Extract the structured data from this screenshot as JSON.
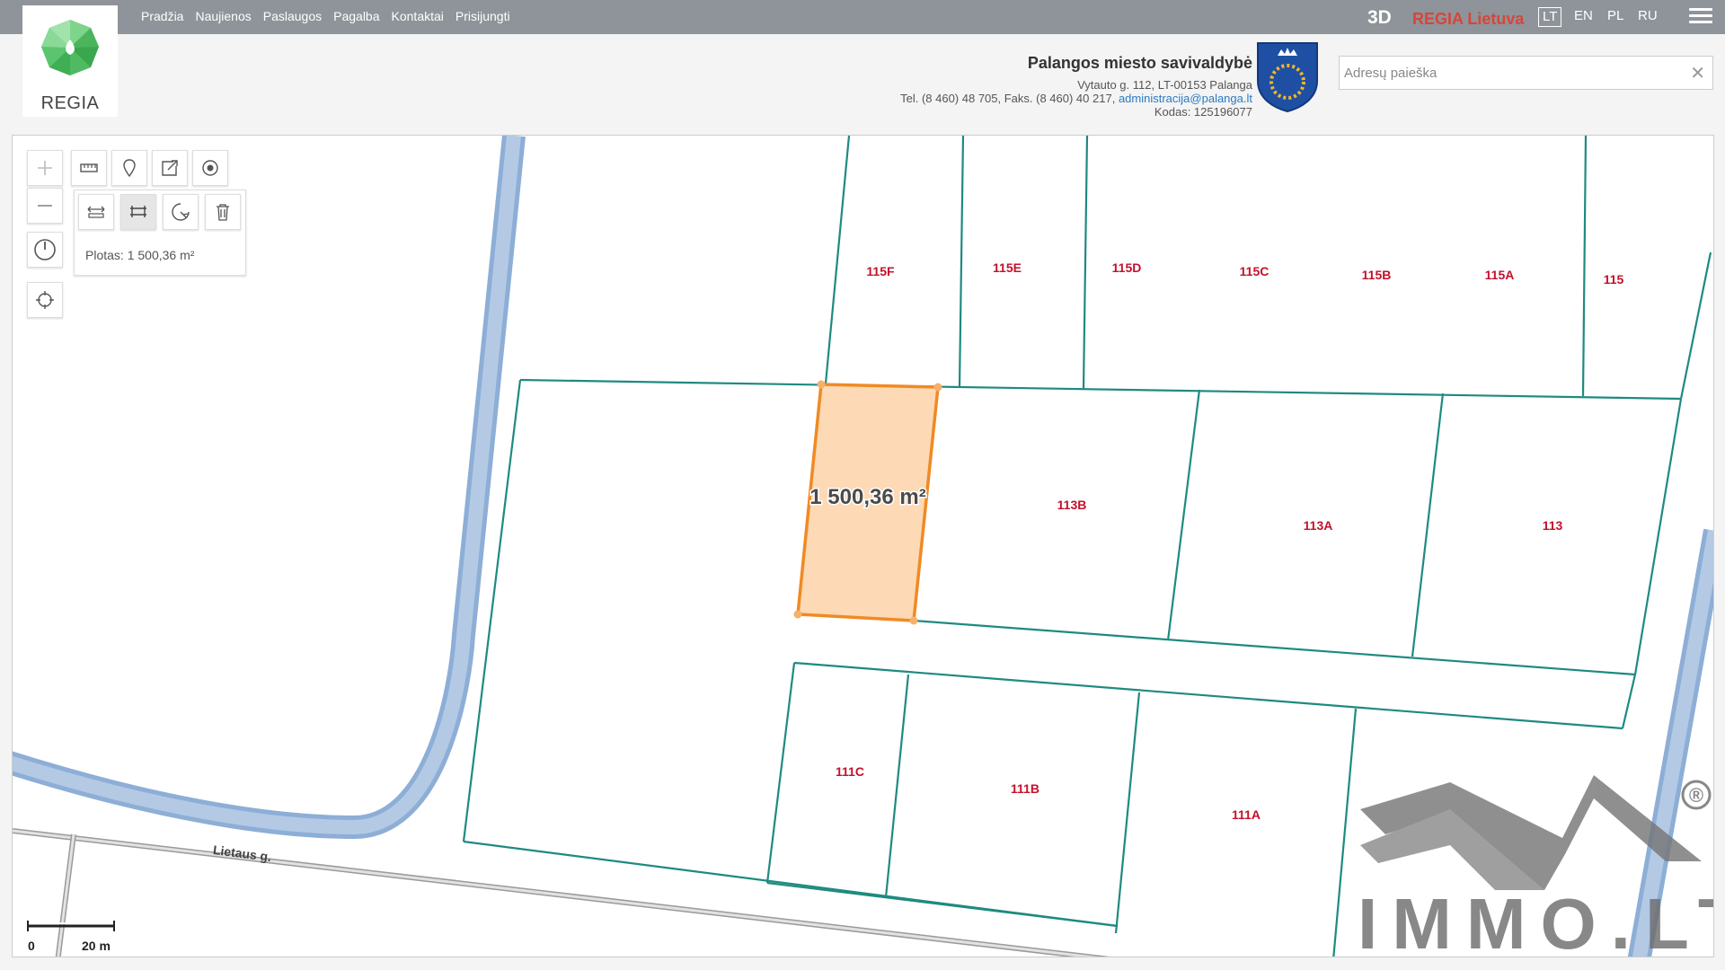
{
  "nav": {
    "items": [
      "Pradžia",
      "Naujienos",
      "Paslaugos",
      "Pagalba",
      "Kontaktai",
      "Prisijungti"
    ]
  },
  "top_right": {
    "three_d": "3D",
    "regia_lietuva": "REGIA Lietuva",
    "languages": [
      "LT",
      "EN",
      "PL",
      "RU"
    ],
    "active_language": "LT"
  },
  "logo": {
    "text": "REGIA"
  },
  "municipality": {
    "name": "Palangos miesto savivaldybė",
    "address": "Vytauto g. 112, LT-00153 Palanga",
    "phone": "Tel. (8 460) 48 705, Faks. (8 460) 40 217,",
    "email": "administracija@palanga.lt",
    "code": "Kodas: 125196077"
  },
  "search": {
    "placeholder": "Adresų paieška"
  },
  "measure": {
    "area_text": "Plotas: 1 500,36 m²"
  },
  "map": {
    "selected_area_label": "1 500,36 m²",
    "plots": [
      "115F",
      "115E",
      "115D",
      "115C",
      "115B",
      "115A",
      "115",
      "113B",
      "113A",
      "113",
      "111C",
      "111B",
      "111A"
    ],
    "street": "Lietaus g.",
    "scale": {
      "start": "0",
      "end": "20 m"
    }
  },
  "watermark": {
    "text": "IMMO.LT",
    "registered": "®"
  },
  "colors": {
    "topbar": "#8e9499",
    "parcel_border": "#1f8a80",
    "selected_fill": "#fdd9b5",
    "selected_border": "#f08a24",
    "road": "#a7bfdc",
    "plot_label": "#c3112a",
    "accent_red": "#d9443a"
  }
}
